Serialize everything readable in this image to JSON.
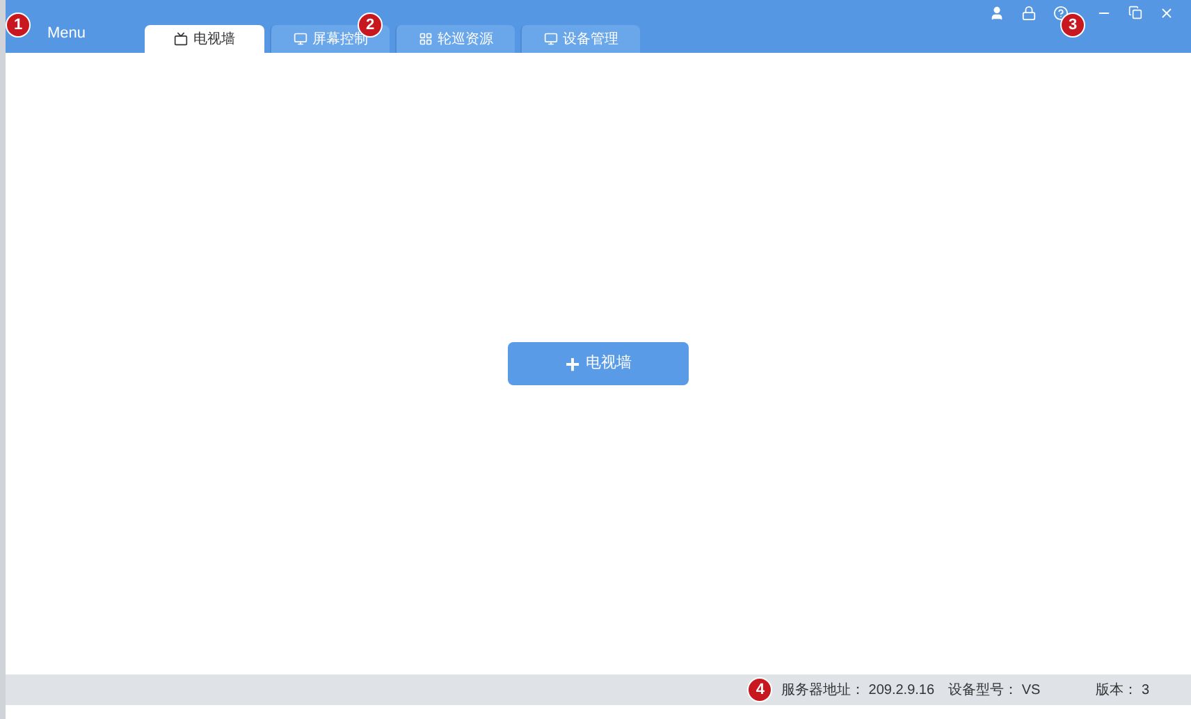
{
  "menu": {
    "label": "Menu"
  },
  "tabs": [
    {
      "label": "电视墙",
      "selected": true
    },
    {
      "label": "屏幕控制",
      "selected": false
    },
    {
      "label": "轮巡资源",
      "selected": false
    },
    {
      "label": "设备管理",
      "selected": false
    }
  ],
  "add_button": {
    "icon": "+",
    "label": "电视墙"
  },
  "callouts": [
    "1",
    "2",
    "3",
    "4"
  ],
  "status_bar": [
    {
      "label": "服务器地址：",
      "value": "209.2.9.16"
    },
    {
      "label": "设备型号：",
      "value": "VS"
    },
    {
      "label": "版本：",
      "value": "3"
    }
  ]
}
